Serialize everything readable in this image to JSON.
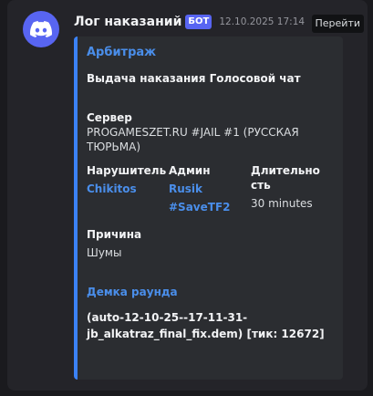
{
  "message": {
    "username": "Лог наказаний",
    "bot_badge": "БОТ",
    "timestamp": "12.10.2025 17:14",
    "jump_label": "Перейти"
  },
  "embed": {
    "author": "Арбитраж",
    "title": "Выдача наказания Голосовой чат",
    "server": {
      "name": "Сервер",
      "value": "PROGAMESZET.RU #JAIL #1 (РУССКАЯ ТЮРЬМА)"
    },
    "offender": {
      "name": "Нарушитель",
      "value": "Chikitos"
    },
    "admin": {
      "name": "Админ",
      "value_line1": "Rusik",
      "value_line2": "#SaveTF2"
    },
    "duration": {
      "name": "Длительность",
      "value": "30 minutes"
    },
    "reason": {
      "name": "Причина",
      "value": "Шумы"
    },
    "demo": {
      "title": "Демка раунда",
      "description": "(auto-12-10-25--17-11-31-jb_alkatraz_final_fix.dem) [тик: 12672]"
    }
  },
  "colors": {
    "accent": "#3b82f6",
    "link": "#4a8eea",
    "brand": "#5865f2"
  },
  "icons": {
    "avatar": "discord-logo-icon"
  }
}
